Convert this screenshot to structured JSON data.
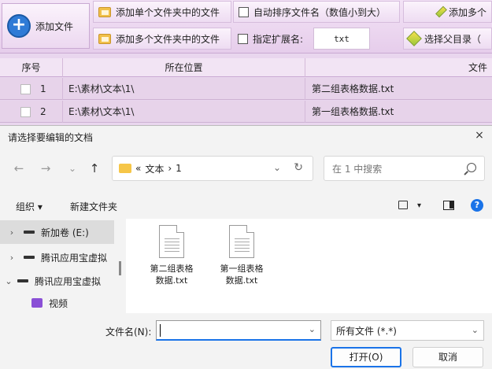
{
  "toolbar": {
    "add_file": "添加文件",
    "add_single_folder": "添加单个文件夹中的文件",
    "auto_sort": "自动排序文件名（数值小到大）",
    "add_more_partial": "添加多个",
    "add_multi_folder": "添加多个文件夹中的文件",
    "specify_ext_label": "指定扩展名:",
    "ext_value": "txt",
    "select_parent_partial": "选择父目录（"
  },
  "grid": {
    "headers": [
      "序号",
      "所在位置",
      "文件"
    ],
    "rows": [
      {
        "num": "1",
        "location": "E:\\素材\\文本\\1\\",
        "file": "第二组表格数据.txt"
      },
      {
        "num": "2",
        "location": "E:\\素材\\文本\\1\\",
        "file": "第一组表格数据.txt"
      }
    ]
  },
  "dialog": {
    "title": "请选择要编辑的文档",
    "close": "×",
    "back": "←",
    "forward": "→",
    "recent": "⌄",
    "up": "↑",
    "breadcrumb": {
      "prefix": "«",
      "parts": [
        "文本",
        "›",
        "1"
      ]
    },
    "refresh": "↻",
    "search_placeholder": "在 1 中搜索",
    "organize": "组织 ▾",
    "new_folder": "新建文件夹",
    "view_dropdown": "▾",
    "help": "?",
    "nav": [
      {
        "chev": "›",
        "label": "新加卷 (E:)"
      },
      {
        "chev": "›",
        "label": "腾讯应用宝虚拟"
      },
      {
        "chev": "⌄",
        "label": "腾讯应用宝虚拟"
      },
      {
        "chev": "",
        "label": "视频"
      }
    ],
    "files": [
      {
        "line1": "第二组表格",
        "line2": "数据.txt"
      },
      {
        "line1": "第一组表格",
        "line2": "数据.txt"
      }
    ],
    "filename_label": "文件名(N):",
    "filename_value": "",
    "filter_value": "所有文件 (*.*)",
    "open": "打开(O)",
    "cancel": "取消"
  },
  "colors": {
    "accent": "#1a73e8",
    "app_bg": "#e9d6ee"
  }
}
